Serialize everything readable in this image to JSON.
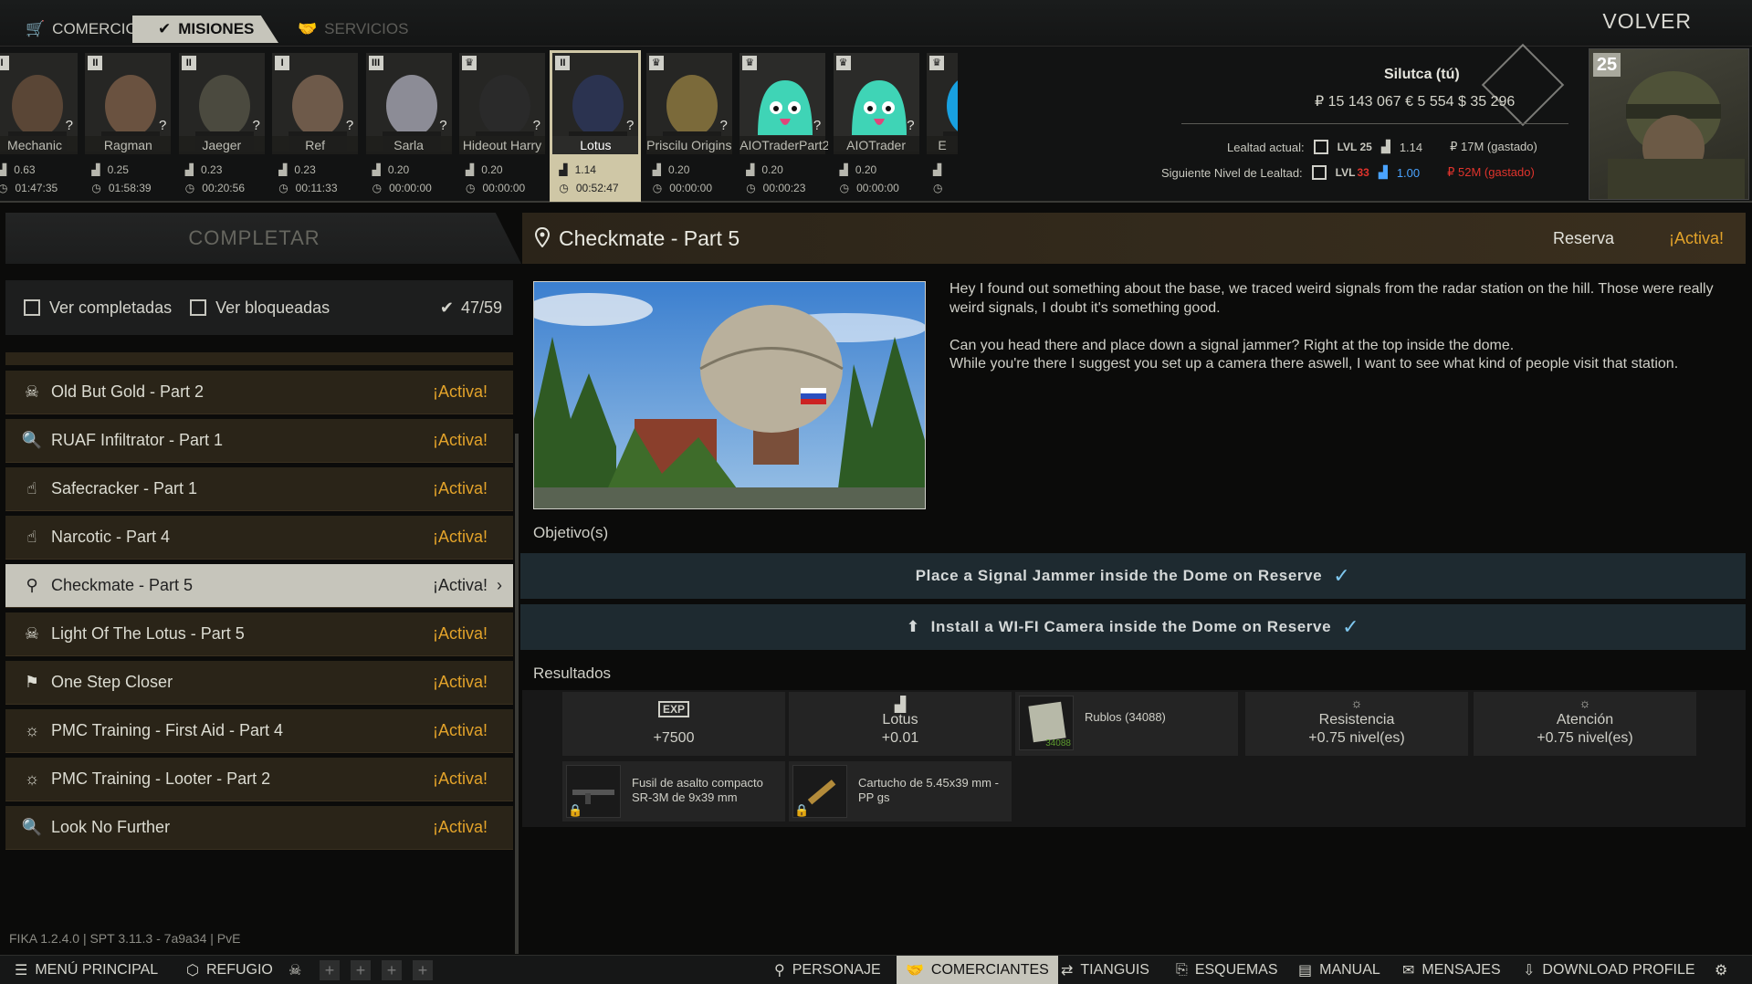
{
  "top_tabs": {
    "trade": "COMERCIO",
    "quests": "MISIONES",
    "services": "SERVICIOS",
    "back": "VOLVER"
  },
  "traders": [
    {
      "name": "Mechanic",
      "rank": "I",
      "rep": "0.63",
      "time": "01:47:35"
    },
    {
      "name": "Ragman",
      "rank": "II",
      "rep": "0.25",
      "time": "01:58:39"
    },
    {
      "name": "Jaeger",
      "rank": "II",
      "rep": "0.23",
      "time": "00:20:56"
    },
    {
      "name": "Ref",
      "rank": "I",
      "rep": "0.23",
      "time": "00:11:33"
    },
    {
      "name": "Sarla",
      "rank": "III",
      "rep": "0.20",
      "time": "00:00:00"
    },
    {
      "name": "Hideout Harry",
      "rank": "♛",
      "rep": "0.20",
      "time": "00:00:00"
    },
    {
      "name": "Lotus",
      "rank": "II",
      "rep": "1.14",
      "time": "00:52:47"
    },
    {
      "name": "Priscilu Origins",
      "rank": "♛",
      "rep": "0.20",
      "time": "00:00:00"
    },
    {
      "name": "AIOTraderPart2",
      "rank": "♛",
      "rep": "0.20",
      "time": "00:00:23"
    },
    {
      "name": "AIOTrader",
      "rank": "♛",
      "rep": "0.20",
      "time": "00:00:00"
    },
    {
      "name": "E",
      "rank": "♛",
      "rep": "",
      "time": ""
    }
  ],
  "player": {
    "name": "Silutca (tú)",
    "money": "₽ 15 143 067  € 5 554  $ 35 296",
    "level": "25",
    "loyalty_current_label": "Lealtad actual:",
    "loyalty_current_lvl": "LVL 25",
    "loyalty_current_rep": "1.14",
    "loyalty_current_spent": "₽ 17M (gastado)",
    "loyalty_next_label": "Siguiente Nivel de Lealtad:",
    "loyalty_next_lvl_prefix": "LVL",
    "loyalty_next_lvl": "33",
    "loyalty_next_rep": "1.00",
    "loyalty_next_spent": "₽ 52M (gastado)"
  },
  "left_panel": {
    "header": "COMPLETAR",
    "show_completed": "Ver completadas",
    "show_locked": "Ver bloqueadas",
    "count": "47/59",
    "version": "FIKA 1.2.4.0 | SPT 3.11.3 - 7a9a34 | PvE"
  },
  "quests": [
    {
      "title": "Old But Gold - Part 2",
      "status": "¡Activa!",
      "icon": "skull-icon"
    },
    {
      "title": "RUAF Infiltrator - Part 1",
      "status": "¡Activa!",
      "icon": "magnifier-icon"
    },
    {
      "title": "Safecracker - Part 1",
      "status": "¡Activa!",
      "icon": "hand-icon"
    },
    {
      "title": "Narcotic - Part 4",
      "status": "¡Activa!",
      "icon": "hand-icon"
    },
    {
      "title": "Checkmate - Part 5",
      "status": "¡Activa!",
      "icon": "pin-icon"
    },
    {
      "title": "Light Of The Lotus - Part 5",
      "status": "¡Activa!",
      "icon": "skull-icon"
    },
    {
      "title": "One Step Closer",
      "status": "¡Activa!",
      "icon": "runner-icon"
    },
    {
      "title": "PMC Training - First Aid - Part 4",
      "status": "¡Activa!",
      "icon": "bulb-icon"
    },
    {
      "title": "PMC Training - Looter - Part 2",
      "status": "¡Activa!",
      "icon": "bulb-icon"
    },
    {
      "title": "Look No Further",
      "status": "¡Activa!",
      "icon": "magnifier-icon"
    }
  ],
  "detail": {
    "title": "Checkmate - Part 5",
    "location": "Reserva",
    "status": "¡Activa!",
    "description": "Hey I found out something about the base, we traced weird signals from the radar station on the hill. Those were really weird signals, I doubt it's something good.\n\nCan you head there and place down a signal jammer? Right at the top inside the dome.\nWhile you're there I suggest you set up a camera there aswell, I want to see what kind of people visit that station.",
    "objectives_label": "Objetivo(s)",
    "objectives": [
      "Place a Signal Jammer inside the Dome on Reserve",
      "Install a WI-FI Camera inside the Dome on Reserve"
    ],
    "results_label": "Resultados",
    "rewards": {
      "exp_badge": "EXP",
      "exp": "+7500",
      "trader_name": "Lotus",
      "trader_rep": "+0.01",
      "rubles": "Rublos (34088)",
      "rubles_stack": "34088",
      "skill1_name": "Resistencia",
      "skill1_val": "+0.75 nivel(es)",
      "skill2_name": "Atención",
      "skill2_val": "+0.75 nivel(es)",
      "item1": "Fusil de asalto compacto SR-3M de 9x39 mm",
      "item2": "Cartucho de 5.45x39 mm - PP gs"
    }
  },
  "bottom_bar": {
    "main_menu": "MENÚ PRINCIPAL",
    "hideout": "REFUGIO",
    "character": "PERSONAJE",
    "traders": "COMERCIANTES",
    "flea": "TIANGUIS",
    "builds": "ESQUEMAS",
    "manual": "MANUAL",
    "messages": "MENSAJES",
    "download": "DOWNLOAD PROFILE"
  },
  "colors": {
    "accent_orange": "#e3a32a",
    "objective_bg": "#1e2a30",
    "check_blue": "#7fc7ee",
    "selected_bg": "#c6c5bb"
  }
}
